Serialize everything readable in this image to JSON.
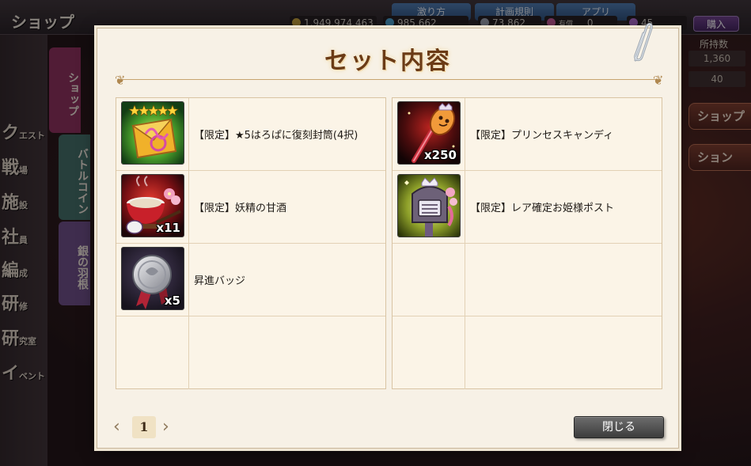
{
  "background": {
    "screen_title": "ショップ",
    "currencies": [
      {
        "value": "1,949,974,463",
        "icon": "coin-icon",
        "color": "#c9a43a"
      },
      {
        "value": "985,662",
        "icon": "crystal-icon",
        "color": "#4aa6d8"
      },
      {
        "value": "73,862",
        "icon": "feather-icon",
        "color": "#9fa7b5"
      },
      {
        "value": "0",
        "label": "有償",
        "icon": "gem-icon",
        "color": "#c85a9a"
      },
      {
        "value": "45",
        "icon": "gem-icon",
        "color": "#b06ad0"
      }
    ],
    "tabs_top": [
      "激り方",
      "計画規則",
      "アプリ"
    ],
    "buy_label": "購入",
    "stock_label": "所持数",
    "stock_values": [
      "1,360",
      "40"
    ],
    "side_buttons": [
      "ショップ",
      "ション"
    ],
    "left_nav": [
      {
        "big": "ク",
        "small": "エスト"
      },
      {
        "big": "戦",
        "small": "場"
      },
      {
        "big": "施",
        "small": "設"
      },
      {
        "big": "社",
        "small": "員"
      },
      {
        "big": "編",
        "small": "成"
      },
      {
        "big": "研",
        "small": "修"
      },
      {
        "big": "研",
        "small": "究室"
      },
      {
        "big": "イ",
        "small": "ベント"
      }
    ],
    "shop_tabs": [
      "ショップ",
      "バトルコイン",
      "銀の羽根"
    ]
  },
  "dialog": {
    "title": "セット内容",
    "left_items": [
      {
        "name": "【限定】★5はろぱに復刻封筒(4択)",
        "qty": "",
        "icon": "envelope-icon",
        "stars": 5
      },
      {
        "name": "【限定】妖精の甘酒",
        "qty": "x11",
        "icon": "amazake-cup-icon"
      },
      {
        "name": "昇進バッジ",
        "qty": "x5",
        "icon": "promotion-badge-icon"
      },
      {
        "name": "",
        "qty": "",
        "icon": ""
      }
    ],
    "right_items": [
      {
        "name": "【限定】プリンセスキャンディ",
        "qty": "x250",
        "icon": "candy-icon"
      },
      {
        "name": "【限定】レア確定お姫様ポスト",
        "qty": "",
        "icon": "princess-post-icon"
      },
      {
        "name": "",
        "qty": "",
        "icon": ""
      },
      {
        "name": "",
        "qty": "",
        "icon": ""
      }
    ],
    "page": "1",
    "prev_arrow": "‹",
    "next_arrow": "›",
    "close_label": "閉じる"
  }
}
